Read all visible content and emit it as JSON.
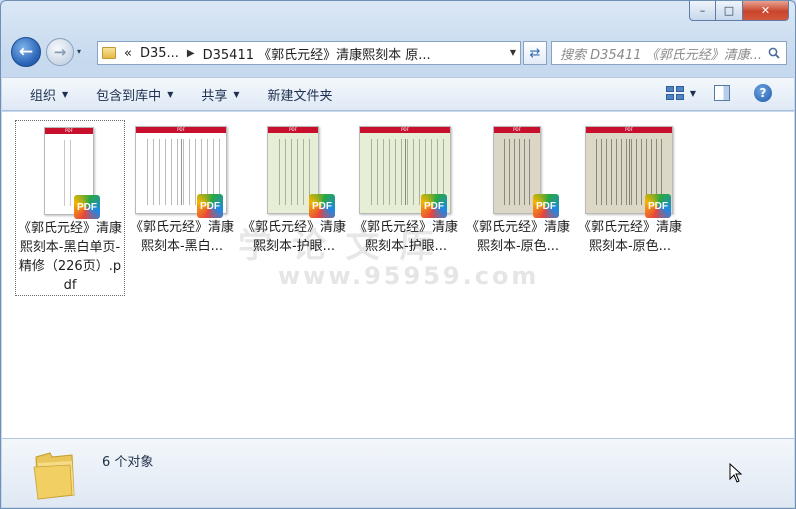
{
  "window": {
    "caption": {
      "min": "–",
      "max": "□",
      "close": "✕"
    }
  },
  "nav": {
    "recent_arrow": "▾",
    "address_parts": [
      "D35...",
      "D35411 《郭氏元经》清康熙刻本 原..."
    ],
    "address_lead": "«",
    "search_placeholder": "搜索 D35411 《郭氏元经》清康..."
  },
  "toolbar": {
    "organize": "组织",
    "include_library": "包含到库中",
    "share": "共享",
    "new_folder": "新建文件夹",
    "help": "?"
  },
  "watermark": {
    "line1": "学 论 文 库",
    "line2": "www.95959.com"
  },
  "files": [
    {
      "label": "《郭氏元经》清康熙刻本-黑白单页-精修（226页）.pdf",
      "tint": "#ffffff",
      "selected": true
    },
    {
      "label": "《郭氏元经》清康熙刻本-黑白...",
      "tint": "#ffffff",
      "selected": false
    },
    {
      "label": "《郭氏元经》清康熙刻本-护眼...",
      "tint": "#e6eed6",
      "selected": false
    },
    {
      "label": "《郭氏元经》清康熙刻本-护眼...",
      "tint": "#e6eed6",
      "selected": false
    },
    {
      "label": "《郭氏元经》清康熙刻本-原色...",
      "tint": "#dcd6c6",
      "selected": false
    },
    {
      "label": "《郭氏元经》清康熙刻本-原色...",
      "tint": "#ddd7c5",
      "selected": false
    }
  ],
  "pdf_badge": "PDF",
  "thumb_header": "PDF",
  "status": {
    "count_text": "6 个对象"
  }
}
